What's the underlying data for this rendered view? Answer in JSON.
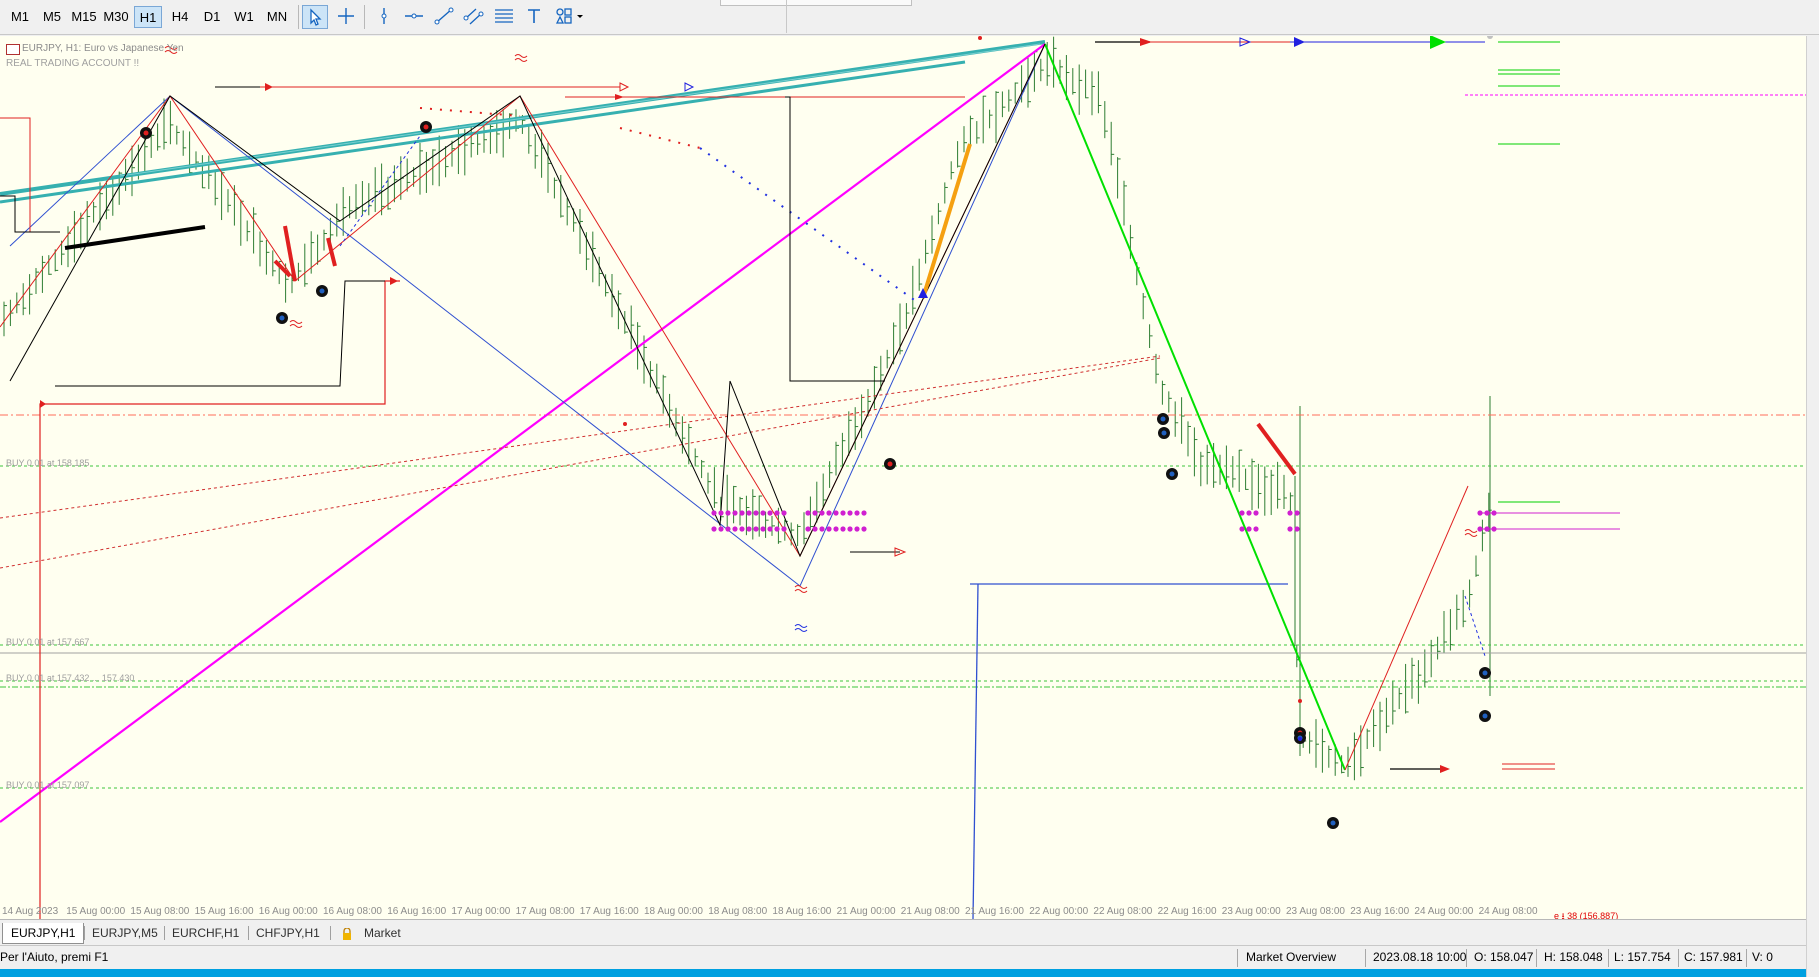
{
  "toolbar": {
    "timeframes": [
      {
        "label": "M1"
      },
      {
        "label": "M5"
      },
      {
        "label": "M15"
      },
      {
        "label": "M30"
      },
      {
        "label": "H1",
        "active": true
      },
      {
        "label": "H4"
      },
      {
        "label": "D1"
      },
      {
        "label": "W1"
      },
      {
        "label": "MN"
      }
    ],
    "tools": [
      "cursor-icon",
      "crosshair-icon",
      "vertical-line-icon",
      "horizontal-line-icon",
      "trendline-icon",
      "equidistant-channel-icon",
      "fibonacci-icon",
      "text-icon",
      "shapes-icon"
    ]
  },
  "chart": {
    "symbol_header": "EURJPY, H1:  Euro vs Japanese Yen",
    "account_label": "REAL TRADING ACCOUNT !!",
    "levels": [
      {
        "label": "BUY 0.01 at 158.185"
      },
      {
        "label": "BUY 0.01 at 157.667"
      },
      {
        "label": "BUY 0.01 at 157.432 ... 157.430"
      },
      {
        "label": "BUY 0.01 at 157.097"
      }
    ],
    "e_label": "e ⭳ 38 (156.887)",
    "x_labels": [
      "14 Aug 2023",
      "15 Aug 00:00",
      "15 Aug 08:00",
      "15 Aug 16:00",
      "16 Aug 00:00",
      "16 Aug 08:00",
      "16 Aug 16:00",
      "17 Aug 00:00",
      "17 Aug 08:00",
      "17 Aug 16:00",
      "18 Aug 00:00",
      "18 Aug 08:00",
      "18 Aug 16:00",
      "21 Aug 00:00",
      "21 Aug 08:00",
      "21 Aug 16:00",
      "22 Aug 00:00",
      "22 Aug 08:00",
      "22 Aug 16:00",
      "23 Aug 00:00",
      "23 Aug 08:00",
      "23 Aug 16:00",
      "24 Aug 00:00",
      "24 Aug 08:00"
    ],
    "colors": {
      "background": "#fffff0",
      "candles": "#2e7d32",
      "zigzag_magenta": "#ff00ff",
      "trend_teal": "#36b0b0",
      "down_green": "#00e000"
    }
  },
  "tabs": [
    {
      "label": "EURJPY,H1",
      "active": true
    },
    {
      "label": "EURJPY,M5"
    },
    {
      "label": "EURCHF,H1"
    },
    {
      "label": "CHFJPY,H1"
    },
    {
      "label": "Market"
    }
  ],
  "status": {
    "help": "Per l'Aiuto, premi F1",
    "profile": "Market Overview",
    "datetime": "2023.08.18 10:00",
    "open": "O: 158.047",
    "high": "H: 158.048",
    "low": "L: 157.754",
    "close": "C: 157.981",
    "volume": "V: 0"
  }
}
